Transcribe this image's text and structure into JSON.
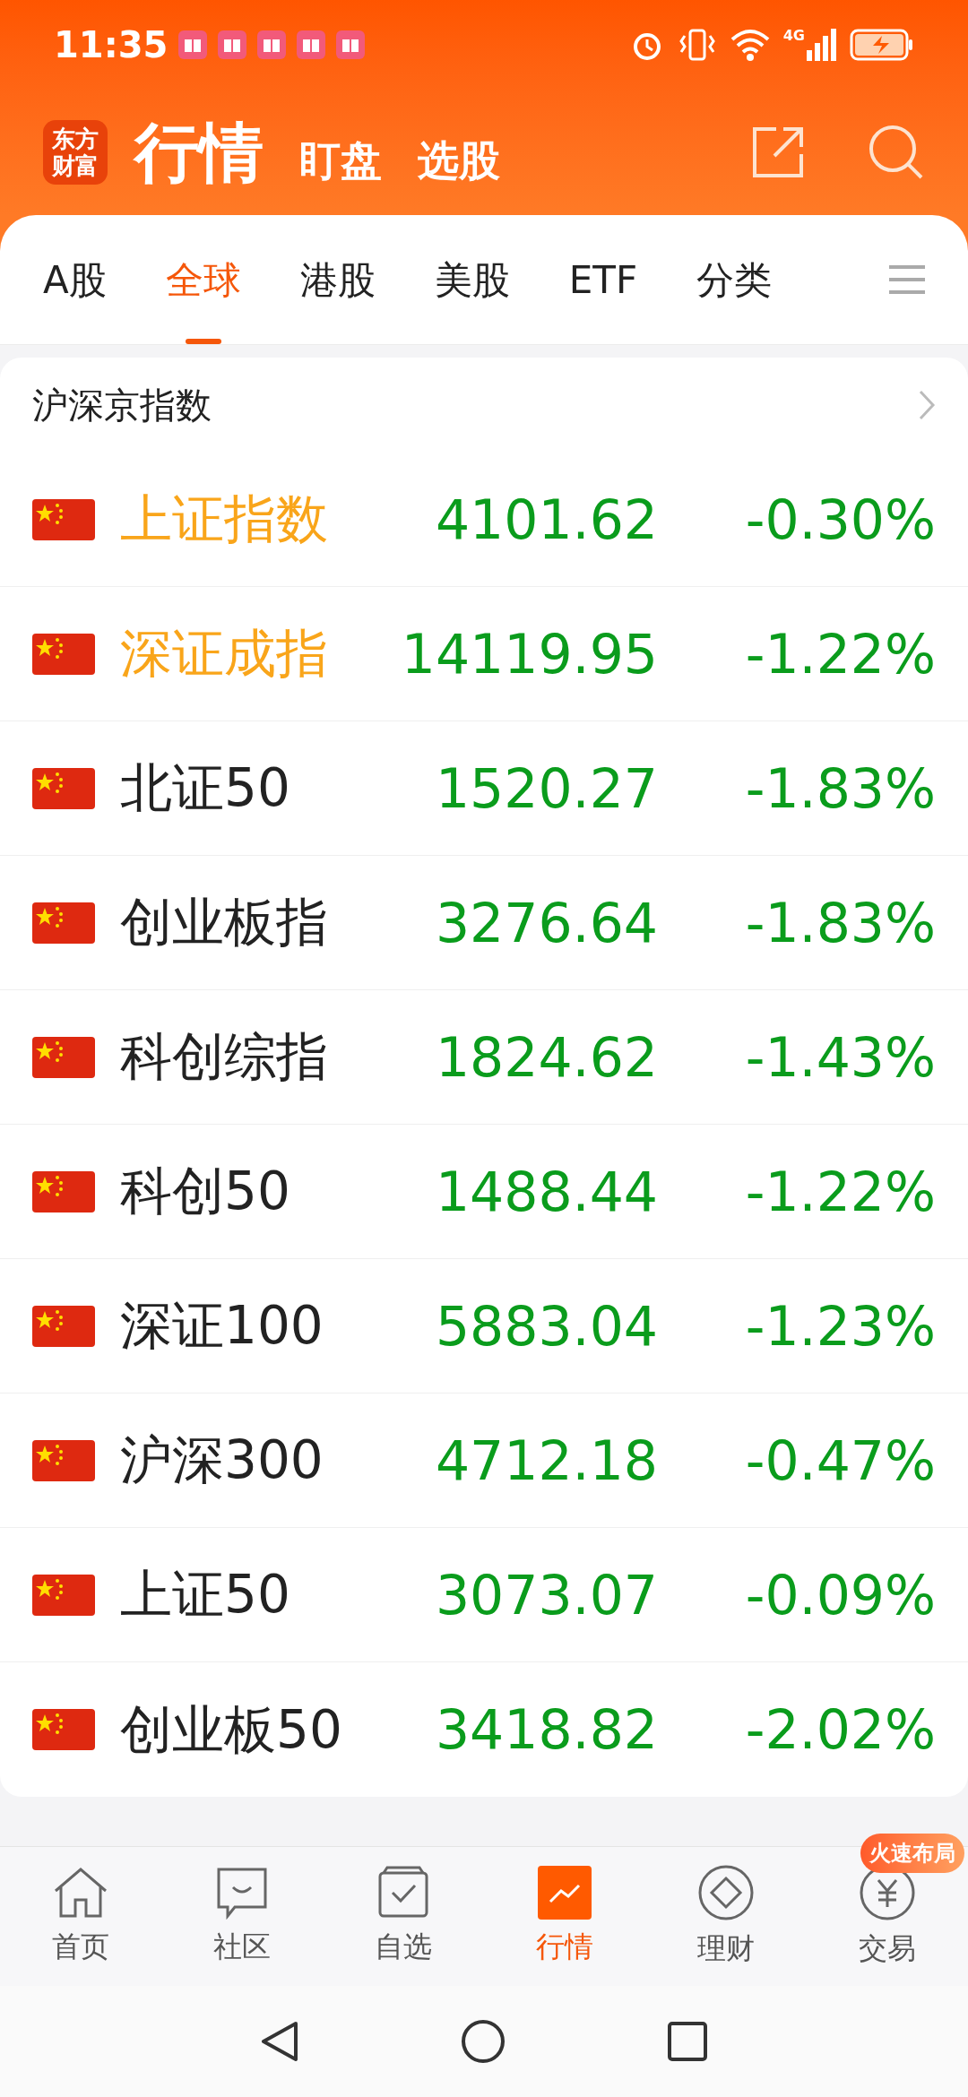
{
  "status_bar": {
    "time": "11:35",
    "network": "4G"
  },
  "header": {
    "logo": "东方财富",
    "title": "行情",
    "links": [
      "盯盘",
      "选股"
    ]
  },
  "tabs": [
    {
      "label": "A股",
      "selected": false
    },
    {
      "label": "全球",
      "selected": true
    },
    {
      "label": "港股",
      "selected": false
    },
    {
      "label": "美股",
      "selected": false
    },
    {
      "label": "ETF",
      "selected": false
    },
    {
      "label": "分类",
      "selected": false
    }
  ],
  "section": {
    "title": "沪深京指数",
    "rows": [
      {
        "name": "上证指数",
        "highlighted": true,
        "price": "4101.62",
        "change": "-0.30%"
      },
      {
        "name": "深证成指",
        "highlighted": true,
        "price": "14119.95",
        "change": "-1.22%"
      },
      {
        "name": "北证50",
        "highlighted": false,
        "price": "1520.27",
        "change": "-1.83%"
      },
      {
        "name": "创业板指",
        "highlighted": false,
        "price": "3276.64",
        "change": "-1.83%"
      },
      {
        "name": "科创综指",
        "highlighted": false,
        "price": "1824.62",
        "change": "-1.43%"
      },
      {
        "name": "科创50",
        "highlighted": false,
        "price": "1488.44",
        "change": "-1.22%"
      },
      {
        "name": "深证100",
        "highlighted": false,
        "price": "5883.04",
        "change": "-1.23%"
      },
      {
        "name": "沪深300",
        "highlighted": false,
        "price": "4712.18",
        "change": "-0.47%"
      },
      {
        "name": "上证50",
        "highlighted": false,
        "price": "3073.07",
        "change": "-0.09%"
      },
      {
        "name": "创业板50",
        "highlighted": false,
        "price": "3418.82",
        "change": "-2.02%"
      }
    ]
  },
  "bottom_nav": [
    {
      "label": "首页",
      "selected": false
    },
    {
      "label": "社区",
      "selected": false
    },
    {
      "label": "自选",
      "selected": false
    },
    {
      "label": "行情",
      "selected": true
    },
    {
      "label": "理财",
      "selected": false
    },
    {
      "label": "交易",
      "selected": false,
      "badge": "火速布局"
    }
  ]
}
